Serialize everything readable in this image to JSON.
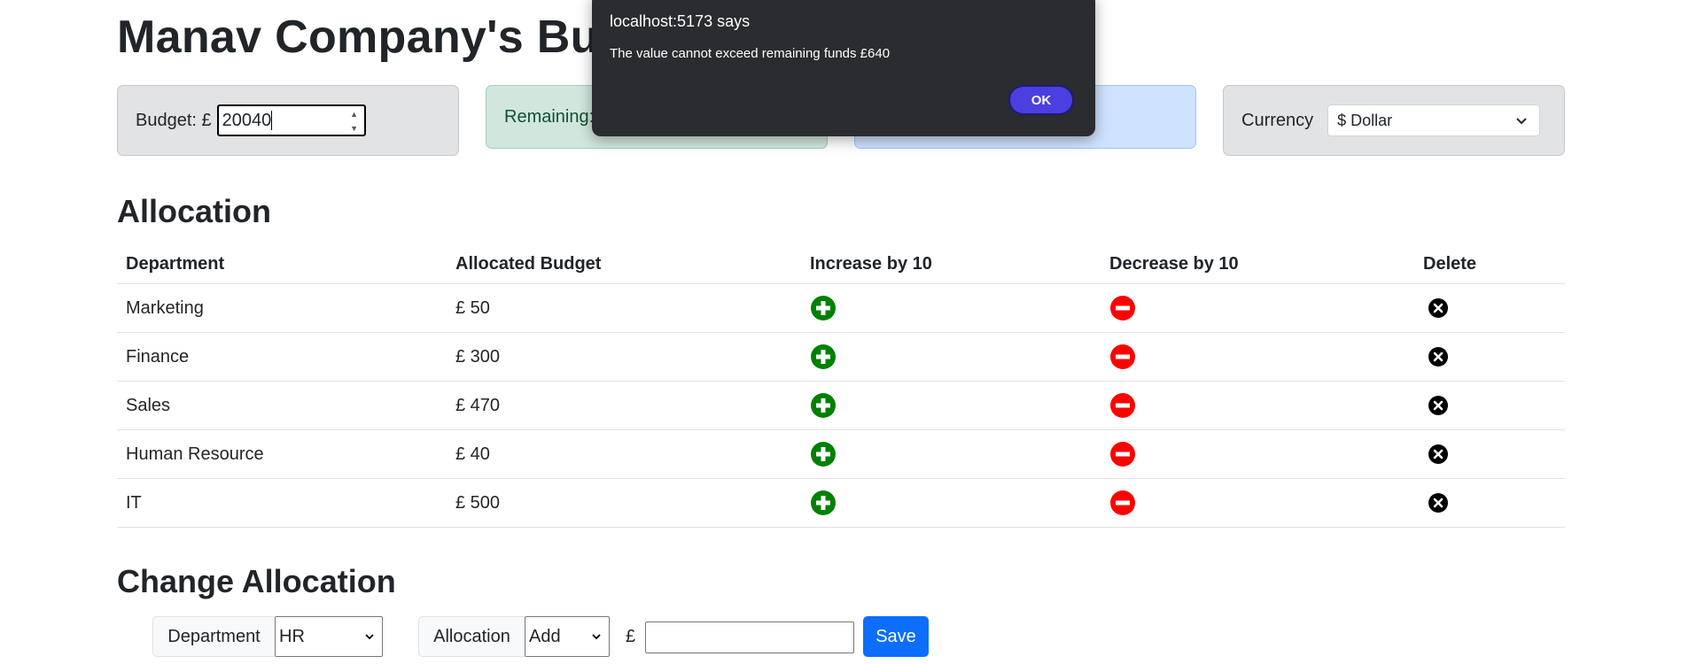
{
  "page_title": "Manav Company's Budget",
  "cards": {
    "budget_label": "Budget: £",
    "budget_value": "20040",
    "remaining_label": "Remaining: £",
    "spent_label": "",
    "currency_label": "Currency",
    "currency_selected": "$ Dollar"
  },
  "allocation": {
    "title": "Allocation",
    "columns": [
      "Department",
      "Allocated Budget",
      "Increase by 10",
      "Decrease by 10",
      "Delete"
    ],
    "rows": [
      {
        "department": "Marketing",
        "budget": "£ 50"
      },
      {
        "department": "Finance",
        "budget": "£ 300"
      },
      {
        "department": "Sales",
        "budget": "£ 470"
      },
      {
        "department": "Human Resource",
        "budget": "£ 40"
      },
      {
        "department": "IT",
        "budget": "£ 500"
      }
    ]
  },
  "change_allocation": {
    "title": "Change Allocation",
    "department_label": "Department",
    "department_selected": "HR",
    "allocation_label": "Allocation",
    "allocation_selected": "Add",
    "currency_symbol": "£",
    "amount_value": "",
    "save_label": "Save"
  },
  "dialog": {
    "origin": "localhost:5173 says",
    "message": "The value cannot exceed remaining funds  £640",
    "ok_label": "OK"
  },
  "colors": {
    "increase": "#008000",
    "decrease": "#ff0000",
    "delete": "#000000",
    "primary": "#0d6efd"
  },
  "icons": {
    "increase": "plus-circle-icon",
    "decrease": "minus-circle-icon",
    "delete": "x-circle-icon"
  }
}
